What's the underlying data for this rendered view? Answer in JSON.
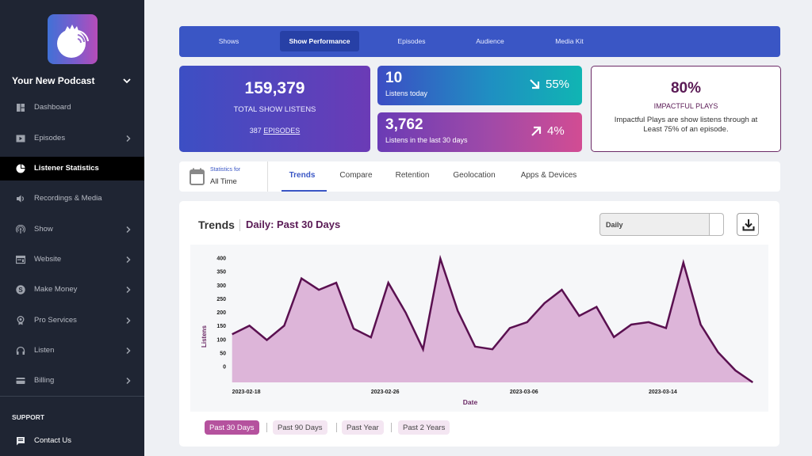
{
  "sidebar": {
    "podcast_name": "Your New Podcast",
    "items": [
      {
        "label": "Dashboard",
        "icon": "dashboard-icon",
        "has_submenu": false,
        "active": false
      },
      {
        "label": "Episodes",
        "icon": "play-icon",
        "has_submenu": true,
        "active": false
      },
      {
        "label": "Listener Statistics",
        "icon": "pie-chart-icon",
        "has_submenu": false,
        "active": true
      },
      {
        "label": "Recordings & Media",
        "icon": "speaker-icon",
        "has_submenu": false,
        "active": false
      },
      {
        "label": "Show",
        "icon": "podcast-icon",
        "has_submenu": true,
        "active": false
      },
      {
        "label": "Website",
        "icon": "browser-icon",
        "has_submenu": true,
        "active": false
      },
      {
        "label": "Make Money",
        "icon": "money-icon",
        "has_submenu": true,
        "active": false
      },
      {
        "label": "Pro Services",
        "icon": "award-icon",
        "has_submenu": true,
        "active": false
      },
      {
        "label": "Listen",
        "icon": "headphones-icon",
        "has_submenu": true,
        "active": false
      },
      {
        "label": "Billing",
        "icon": "credit-card-icon",
        "has_submenu": true,
        "active": false
      }
    ],
    "support_heading": "SUPPORT",
    "support_items": [
      {
        "label": "Contact Us",
        "icon": "message-icon"
      }
    ]
  },
  "top_nav": {
    "tabs": [
      {
        "label": "Shows",
        "active": false
      },
      {
        "label": "Show Performance",
        "active": true
      },
      {
        "label": "Episodes",
        "active": false
      },
      {
        "label": "Audience",
        "active": false
      },
      {
        "label": "Media Kit",
        "active": false
      }
    ]
  },
  "stats": {
    "total": {
      "value": "159,379",
      "label": "TOTAL SHOW LISTENS",
      "episodes_count": "387",
      "episodes_link": "EPISODES"
    },
    "today": {
      "value": "10",
      "label": "Listens today",
      "change": "55%",
      "direction": "down"
    },
    "last_30_days": {
      "value": "3,762",
      "label": "Listens in the last 30 days",
      "change": "4%",
      "direction": "up"
    },
    "impactful": {
      "value": "80%",
      "label": "IMPACTFUL PLAYS",
      "description_lines": [
        "Impactful Plays are show listens through at",
        "Least 75% of an episode."
      ]
    }
  },
  "filter": {
    "statistics_for_label": "Statistics for",
    "period": "All Time"
  },
  "analysis_tabs": [
    {
      "label": "Trends",
      "active": true
    },
    {
      "label": "Compare",
      "active": false
    },
    {
      "label": "Retention",
      "active": false
    },
    {
      "label": "Geolocation",
      "active": false
    },
    {
      "label": "Apps & Devices",
      "active": false
    }
  ],
  "trends": {
    "title": "Trends",
    "subtitle": "Daily: Past 30 Days",
    "interval_select": "Daily",
    "ranges": [
      {
        "label": "Past 30 Days",
        "active": true
      },
      {
        "label": "Past 90 Days",
        "active": false
      },
      {
        "label": "Past Year",
        "active": false
      },
      {
        "label": "Past 2 Years",
        "active": false
      }
    ]
  },
  "colors": {
    "sidebar_bg": "#1f2533",
    "nav_blue": "#3a56c5",
    "nav_active": "#2740a6",
    "brand_purple": "#5a1a55",
    "range_active": "#b5529e",
    "chart_line": "#5a1050",
    "chart_fill": "#ddb5d9"
  },
  "chart_data": {
    "type": "area",
    "title": "Trends",
    "xlabel": "Date",
    "ylabel": "Listens",
    "x": [
      "2023-02-17",
      "2023-02-18",
      "2023-02-19",
      "2023-02-20",
      "2023-02-21",
      "2023-02-22",
      "2023-02-23",
      "2023-02-24",
      "2023-02-25",
      "2023-02-26",
      "2023-02-27",
      "2023-02-28",
      "2023-03-01",
      "2023-03-02",
      "2023-03-03",
      "2023-03-04",
      "2023-03-05",
      "2023-03-06",
      "2023-03-07",
      "2023-03-08",
      "2023-03-09",
      "2023-03-10",
      "2023-03-11",
      "2023-03-12",
      "2023-03-13",
      "2023-03-14",
      "2023-03-15",
      "2023-03-16",
      "2023-03-17",
      "2023-03-18",
      "2023-03-19"
    ],
    "series": [
      {
        "name": "Listens",
        "values": [
          119,
          151,
          98,
          151,
          325,
          283,
          309,
          140,
          108,
          309,
          199,
          64,
          398,
          206,
          74,
          64,
          142,
          164,
          234,
          283,
          187,
          220,
          109,
          155,
          164,
          142,
          383,
          155,
          53,
          -14,
          -58
        ]
      }
    ],
    "yticks": [
      0,
      50,
      100,
      150,
      200,
      250,
      300,
      350,
      400
    ],
    "xtick_labels": [
      "2023-02-18",
      "2023-02-26",
      "2023-03-06",
      "2023-03-14"
    ],
    "ylim": [
      -58,
      400
    ],
    "grid": false,
    "legend": "none"
  }
}
